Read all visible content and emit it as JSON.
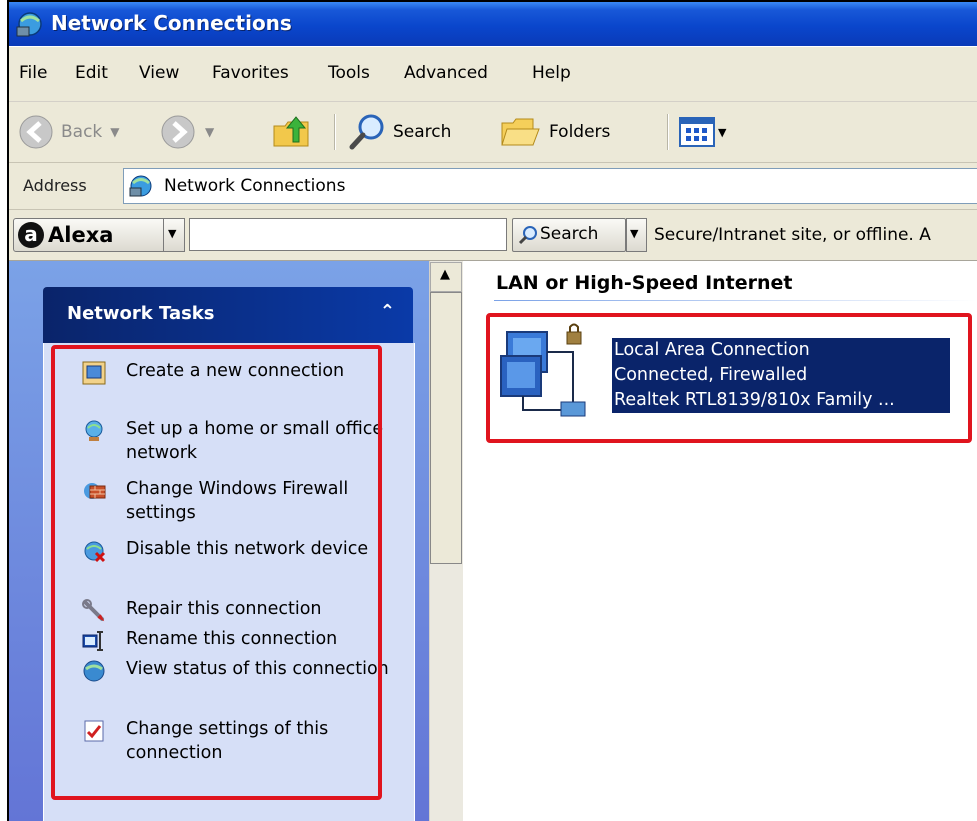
{
  "window": {
    "title": "Network Connections"
  },
  "menu": {
    "items": [
      "File",
      "Edit",
      "View",
      "Favorites",
      "Tools",
      "Advanced",
      "Help"
    ]
  },
  "toolbar": {
    "back_label": "Back",
    "search_label": "Search",
    "folders_label": "Folders"
  },
  "address": {
    "label": "Address",
    "value": "Network Connections"
  },
  "alexa": {
    "brand": "Alexa",
    "logo_letter": "a",
    "input_value": "",
    "search_label": "Search",
    "status_text": "Secure/Intranet site, or offline. A"
  },
  "tasks": {
    "header": "Network Tasks",
    "collapse_glyph": "⌃",
    "items": [
      {
        "label": "Create a new connection",
        "icon": "new-connection-icon"
      },
      {
        "label": "Set up a home or small office network",
        "icon": "home-network-icon"
      },
      {
        "label": "Change Windows Firewall settings",
        "icon": "firewall-icon"
      },
      {
        "label": "Disable this network device",
        "icon": "disable-network-icon"
      },
      {
        "label": "Repair this connection",
        "icon": "wrench-icon"
      },
      {
        "label": "Rename this connection",
        "icon": "rename-icon"
      },
      {
        "label": "View status of this connection",
        "icon": "status-icon"
      },
      {
        "label": "Change settings of this connection",
        "icon": "settings-icon"
      }
    ]
  },
  "content": {
    "group_title": "LAN or High-Speed Internet",
    "connection": {
      "name": "Local Area Connection",
      "status": "Connected, Firewalled",
      "device": "Realtek RTL8139/810x Family ..."
    }
  },
  "colors": {
    "highlight": "#0a246a",
    "annotation": "#e0141e",
    "titlebar": "#0a46cc",
    "task_header": "#0a246a"
  }
}
